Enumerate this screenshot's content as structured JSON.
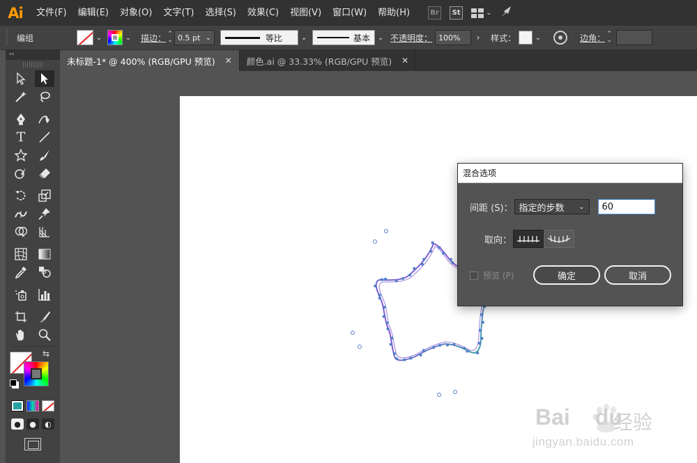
{
  "app": {
    "logo": "Ai"
  },
  "menu": [
    "文件(F)",
    "编辑(E)",
    "对象(O)",
    "文字(T)",
    "选择(S)",
    "效果(C)",
    "视图(V)",
    "窗口(W)",
    "帮助(H)"
  ],
  "menu_right": {
    "bridge_label": "Br",
    "stock_label": "St"
  },
  "controlbar": {
    "panel_name": "编组",
    "stroke_label": "描边",
    "stroke_weight": "0.5 pt",
    "profile_label": "等比",
    "brush_label": "基本",
    "opacity_label": "不透明度",
    "opacity_value": "100%",
    "style_label": "样式",
    "corner_label": "边角"
  },
  "tabs": [
    {
      "label": "未标题-1* @ 400% (RGB/GPU 预览)",
      "active": true
    },
    {
      "label": "颜色.ai @ 33.33% (RGB/GPU 预览)",
      "active": false
    }
  ],
  "toolbar": {
    "collapse_label": "‹‹"
  },
  "dialog": {
    "title": "混合选项",
    "spacing_label": "间距 (S)：",
    "spacing_value": "指定的步数",
    "steps_value": "60",
    "orientation_label": "取向：",
    "preview_label": "预览 (P)",
    "ok_label": "确定",
    "cancel_label": "取消"
  },
  "watermark": {
    "brand": "Bai",
    "brand_suffix": "du",
    "cn": "经验",
    "url": "jingyan.baidu.com"
  },
  "colors": {
    "accent": "#ff9a00",
    "path_purple": "#9b4fd6",
    "path_teal": "#3aa6b0",
    "anchor_blue": "#4f7fc8"
  }
}
